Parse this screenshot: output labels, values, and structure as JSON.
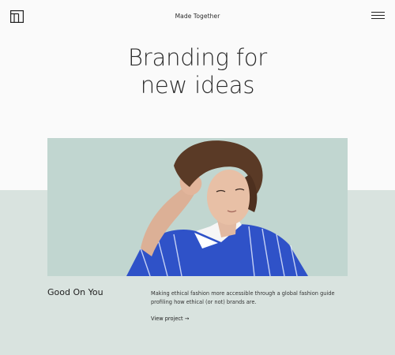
{
  "header": {
    "brand": "Made Together",
    "logo_icon": "studio-logo-icon",
    "menu_icon": "hamburger-menu-icon"
  },
  "hero": {
    "title_line1": "Branding for",
    "title_line2": "new ideas"
  },
  "project": {
    "image": "portrait-photo",
    "name": "Good On You",
    "description": "Making ethical fashion more accessible through a global fashion guide profiling how ethical (or not) brands are.",
    "link_label": "View project →"
  },
  "colors": {
    "background": "#fafafa",
    "band": "#d9e3df",
    "photo_background": "#c1d6d0",
    "shirt": "#2f52c8"
  }
}
